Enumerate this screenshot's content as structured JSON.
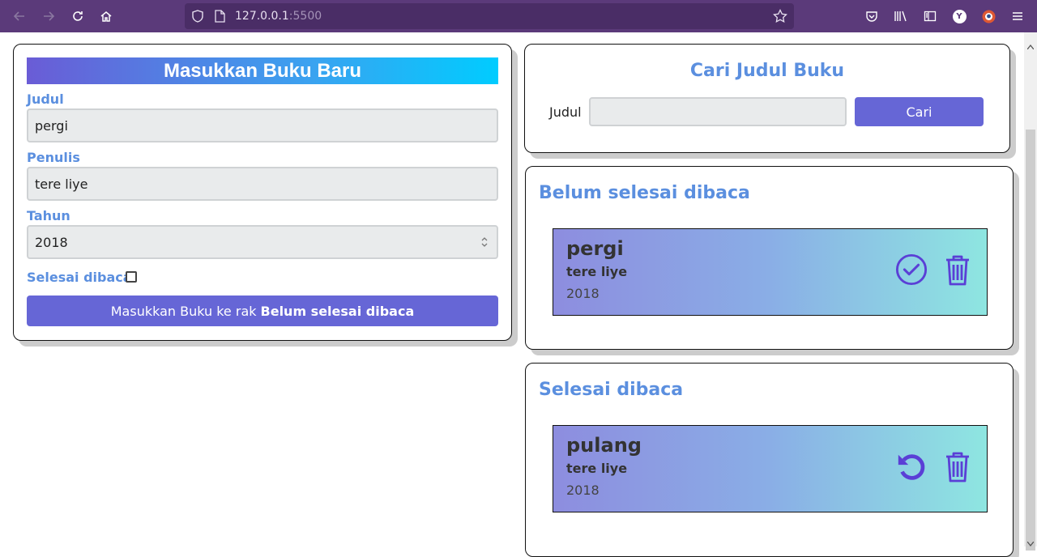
{
  "browser": {
    "url_host": "127.0.0.1",
    "url_port": ":5500",
    "profile_initial": "Y"
  },
  "input_section": {
    "title": "Masukkan Buku Baru",
    "title_label": "Judul",
    "title_value": "pergi",
    "author_label": "Penulis",
    "author_value": "tere liye",
    "year_label": "Tahun",
    "year_value": "2018",
    "complete_label": "Selesai dibaca",
    "complete_checked": false,
    "submit_prefix": "Masukkan Buku ke rak",
    "submit_shelf": "Belum selesai dibaca"
  },
  "search_section": {
    "title": "Cari Judul Buku",
    "label": "Judul",
    "value": "",
    "button": "Cari"
  },
  "incomplete_shelf": {
    "title": "Belum selesai dibaca",
    "books": [
      {
        "title": "pergi",
        "author": "tere liye",
        "year": "2018"
      }
    ]
  },
  "complete_shelf": {
    "title": "Selesai dibaca",
    "books": [
      {
        "title": "pulang",
        "author": "tere liye",
        "year": "2018"
      }
    ]
  },
  "colors": {
    "accent": "#6666d6",
    "heading": "#5b8fdf",
    "icon": "#5a3fd6",
    "chrome": "#5b3a7a"
  }
}
